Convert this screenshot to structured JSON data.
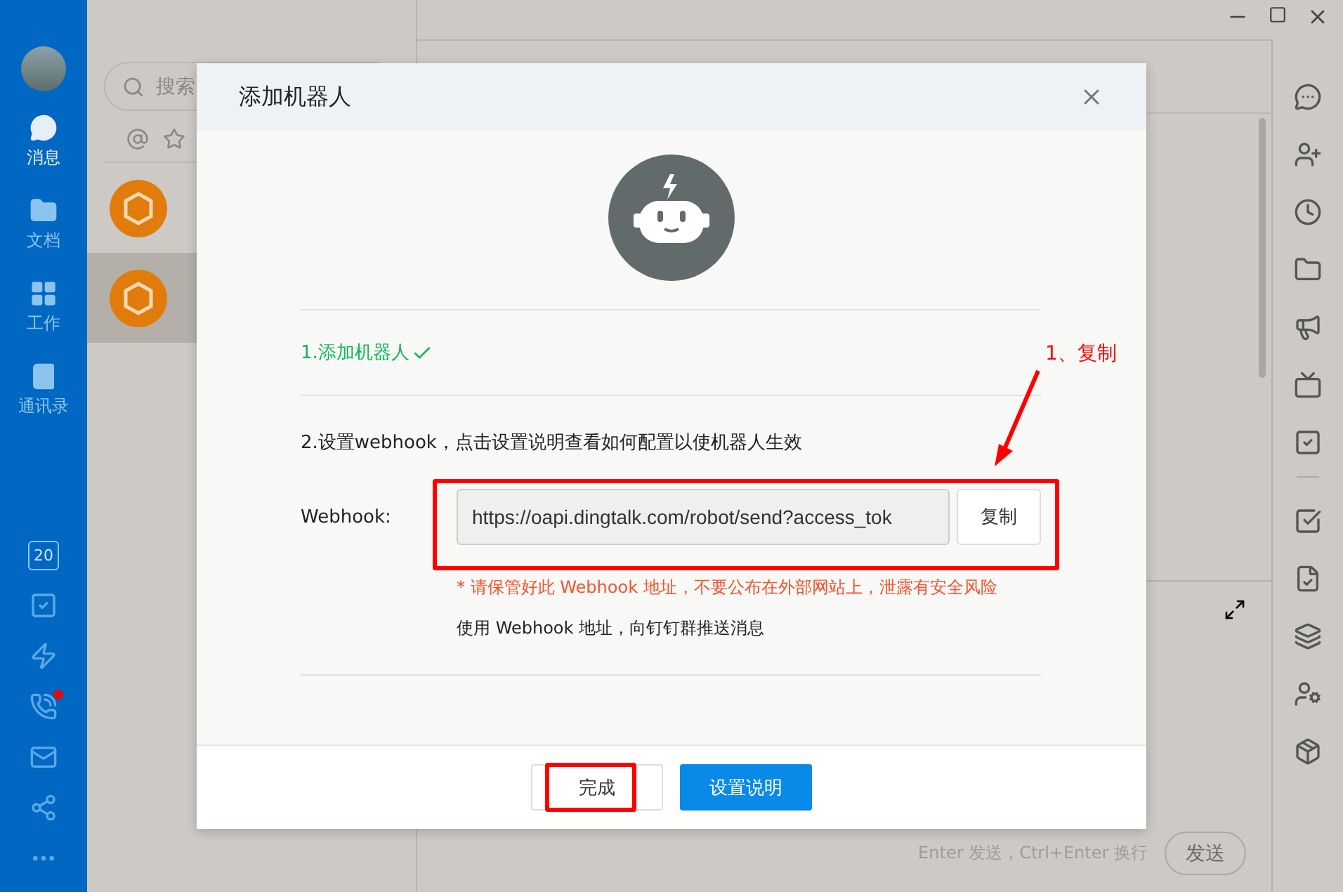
{
  "nav": {
    "items": [
      {
        "label": "消息",
        "selected": true
      },
      {
        "label": "文档",
        "selected": false
      },
      {
        "label": "工作",
        "selected": false
      },
      {
        "label": "通讯录",
        "selected": false
      }
    ],
    "calendar_day": "20",
    "call_badge": true
  },
  "search": {
    "placeholder": "搜索"
  },
  "conversations": [
    {
      "selected": false
    },
    {
      "selected": true
    }
  ],
  "composer": {
    "hint": "Enter 发送，Ctrl+Enter 换行",
    "send": "发送"
  },
  "dialog": {
    "title": "添加机器人",
    "step1": "1.添加机器人",
    "step2": "2.设置webhook，点击设置说明查看如何配置以使机器人生效",
    "webhook_label": "Webhook:",
    "webhook_value": "https://oapi.dingtalk.com/robot/send?access_tok",
    "copy": "复制",
    "warning": "* 请保管好此 Webhook 地址，不要公布在外部网站上，泄露有安全风险",
    "note": "使用 Webhook 地址，向钉钉群推送消息",
    "buttons": [
      {
        "label": "完成",
        "kind": "default"
      },
      {
        "label": "设置说明",
        "kind": "primary"
      }
    ]
  },
  "annotation": {
    "label": "1、复制"
  }
}
